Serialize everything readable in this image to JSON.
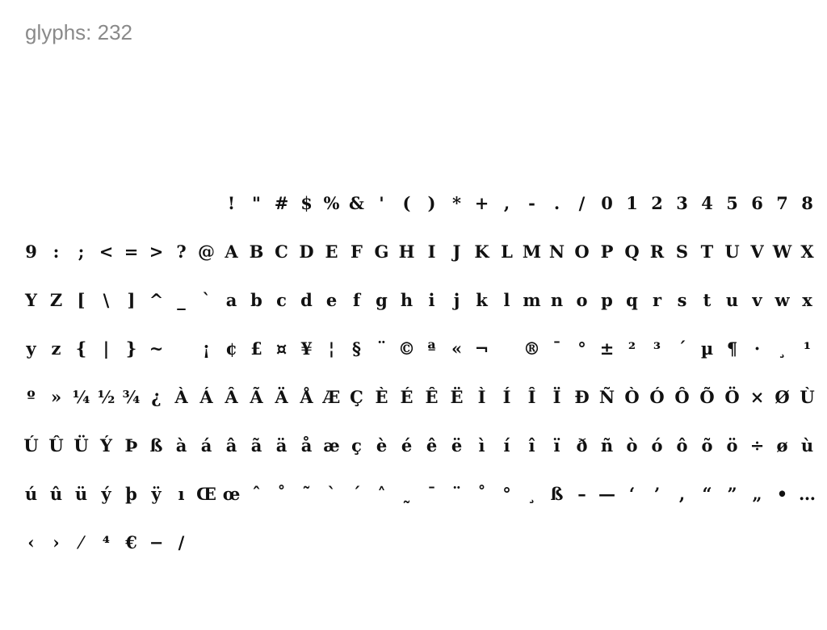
{
  "glyph_count_label": "glyphs: 232",
  "text_color": "#111111",
  "label_color": "#8a8a8a",
  "glyph_rows": [
    [
      " ",
      " ",
      " ",
      " ",
      " ",
      " ",
      " ",
      " ",
      "!",
      "\"",
      "#",
      "$",
      "%",
      "&",
      "'",
      "(",
      ")",
      "*",
      "+",
      ",",
      "-",
      ".",
      "/",
      "0",
      "1",
      "2",
      "3",
      "4",
      "5",
      "6",
      "7",
      "8"
    ],
    [
      "9",
      ":",
      ";",
      "<",
      "=",
      ">",
      "?",
      "@",
      "A",
      "B",
      "C",
      "D",
      "E",
      "F",
      "G",
      "H",
      "I",
      "J",
      "K",
      "L",
      "M",
      "N",
      "O",
      "P",
      "Q",
      "R",
      "S",
      "T",
      "U",
      "V",
      "W",
      "X"
    ],
    [
      "Y",
      "Z",
      "[",
      "\\",
      "]",
      "^",
      "_",
      "`",
      "a",
      "b",
      "c",
      "d",
      "e",
      "f",
      "g",
      "h",
      "i",
      "j",
      "k",
      "l",
      "m",
      "n",
      "o",
      "p",
      "q",
      "r",
      "s",
      "t",
      "u",
      "v",
      "w",
      "x"
    ],
    [
      "y",
      "z",
      "{",
      "|",
      "}",
      "~",
      " ",
      "¡",
      "¢",
      "£",
      "¤",
      "¥",
      "¦",
      "§",
      "¨",
      "©",
      "ª",
      "«",
      "¬",
      " ",
      "®",
      "¯",
      "°",
      "±",
      "²",
      "³",
      "´",
      "µ",
      "¶",
      "·",
      "¸",
      "¹"
    ],
    [
      "º",
      "»",
      "¼",
      "½",
      "¾",
      "¿",
      "À",
      "Á",
      "Â",
      "Ã",
      "Ä",
      "Å",
      "Æ",
      "Ç",
      "È",
      "É",
      "Ê",
      "Ë",
      "Ì",
      "Í",
      "Î",
      "Ï",
      "Ð",
      "Ñ",
      "Ò",
      "Ó",
      "Ô",
      "Õ",
      "Ö",
      "×",
      "Ø",
      "Ù"
    ],
    [
      "Ú",
      "Û",
      "Ü",
      "Ý",
      "Þ",
      "ß",
      "à",
      "á",
      "â",
      "ã",
      "ä",
      "å",
      "æ",
      "ç",
      "è",
      "é",
      "ê",
      "ë",
      "ì",
      "í",
      "î",
      "ï",
      "ð",
      "ñ",
      "ò",
      "ó",
      "ô",
      "õ",
      "ö",
      "÷",
      "ø",
      "ù"
    ],
    [
      "ú",
      "û",
      "ü",
      "ý",
      "þ",
      "ÿ",
      "ı",
      "Œ",
      "œ",
      "ˆ",
      "˚",
      "˜",
      "ˋ",
      "ˊ",
      "˄",
      "˷",
      "ˉ",
      "¨",
      "˚",
      "°",
      "¸",
      "ß",
      "–",
      "—",
      "‘",
      "’",
      ",",
      "“",
      "”",
      "„",
      "•",
      "…"
    ],
    [
      "‹",
      "›",
      "⁄",
      "⁴",
      "€",
      "−",
      "/"
    ]
  ]
}
